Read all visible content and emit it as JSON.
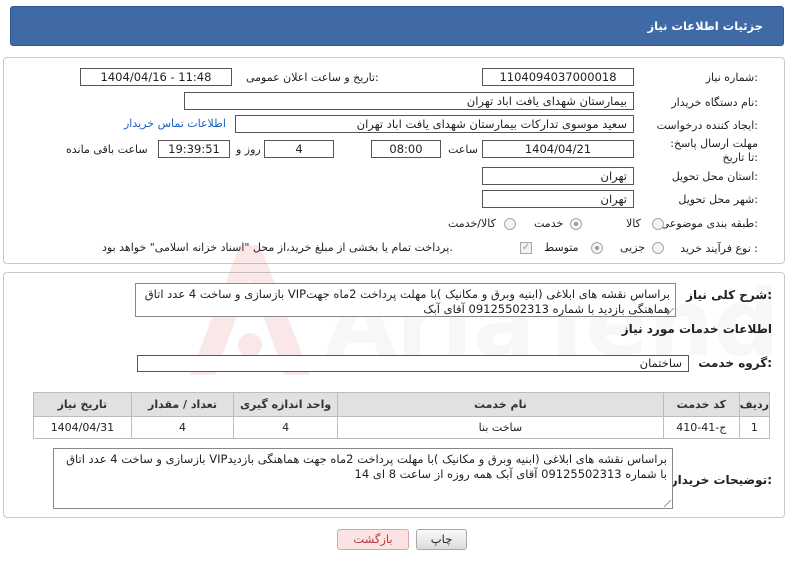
{
  "header": {
    "title": "جزئیات اطلاعات نیاز"
  },
  "fields": {
    "need_number_label": "شماره نیاز:",
    "need_number": "1104094037000018",
    "announce_label": "تاریخ و ساعت اعلان عمومی:",
    "announce_value": "1404/04/16 - 11:48",
    "buyer_org_label": "نام دستگاه خریدار:",
    "buyer_org": "بیمارستان شهدای یافت اباد تهران",
    "requester_label": "ایجاد کننده درخواست:",
    "requester": "سعید موسوی تدارکات بیمارستان شهدای یافت اباد تهران",
    "contact_link": "اطلاعات تماس خریدار",
    "deadline_label": "مهلت ارسال پاسخ: تا تاریخ:",
    "deadline_date": "1404/04/21",
    "time_label": "ساعت",
    "deadline_time": "08:00",
    "days_value": "4",
    "days_label": "روز و",
    "remaining_time": "19:39:51",
    "remaining_label": "ساعت باقی مانده",
    "province_label": "استان محل تحویل:",
    "province": "تهران",
    "city_label": "شهر محل تحویل:",
    "city": "تهران",
    "category_label": "طبقه بندی موضوعی:",
    "category_options": [
      "کالا",
      "خدمت",
      "کالا/خدمت"
    ],
    "process_label": "نوع فرآیند خرید :",
    "process_options": [
      "جزیی",
      "متوسط"
    ],
    "payment_note": "پرداخت تمام یا بخشی از مبلغ خرید،از محل \"اسناد خزانه اسلامی\" خواهد بود."
  },
  "description": {
    "label": "شرح کلی نیاز:",
    "text": "بازسازی و ساخت 4 عدد اتاق VIPبراساس نقشه های ابلاغی (ابنیه وبرق و مکانیک )با مهلت پرداخت 2ماه جهت هماهنگی بازدید با شماره 09125502313 آقای آبک"
  },
  "services": {
    "section_title": "اطلاعات خدمات مورد نیاز",
    "group_label": "گروه خدمت:",
    "group_value": "ساختمان",
    "columns": [
      "ردیف",
      "کد خدمت",
      "نام خدمت",
      "واحد اندازه گیری",
      "تعداد / مقدار",
      "تاریخ نیاز"
    ],
    "rows": [
      {
        "index": "1",
        "code": "ج-41-410",
        "name": "ساخت بنا",
        "unit": "4",
        "qty": "4",
        "date": "1404/04/31"
      }
    ]
  },
  "buyer_notes": {
    "label": "توضیحات خریدار:",
    "text": "بازسازی و ساخت 4 عدد اتاق VIPبراساس نقشه های ابلاغی (ابنیه وبرق و مکانیک )با مهلت پرداخت 2ماه جهت هماهنگی بازدید با شماره 09125502313 آقای آبک  همه روزه از ساعت 8 ای 14"
  },
  "buttons": {
    "print": "چاپ",
    "back": "بازگشت"
  },
  "colors": {
    "header": "#3f6aa6",
    "link": "#1a5ec4",
    "back_button": "#fbe3e3"
  }
}
